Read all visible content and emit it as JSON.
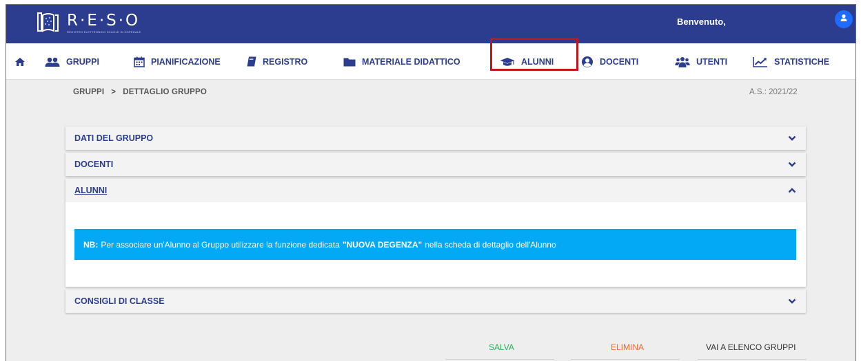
{
  "header": {
    "logo_title": "R·E·S·O",
    "logo_subtitle": "REGISTRO ELETTRONICO SCUOLE IN OSPEDALE",
    "welcome": "Benvenuto,"
  },
  "nav": {
    "items": [
      {
        "label": "GRUPPI",
        "icon": "users-icon"
      },
      {
        "label": "PIANIFICAZIONE",
        "icon": "calendar-icon"
      },
      {
        "label": "REGISTRO",
        "icon": "book-icon"
      },
      {
        "label": "MATERIALE DIDATTICO",
        "icon": "folder-icon"
      },
      {
        "label": "ALUNNI",
        "icon": "graduation-cap-icon"
      },
      {
        "label": "DOCENTI",
        "icon": "user-circle-icon"
      },
      {
        "label": "UTENTI",
        "icon": "group-icon"
      },
      {
        "label": "STATISTICHE",
        "icon": "chart-line-icon"
      }
    ]
  },
  "breadcrumb": {
    "root": "GRUPPI",
    "separator": ">",
    "current": "DETTAGLIO GRUPPO"
  },
  "year": "A.S.: 2021/22",
  "sections": {
    "dati": "DATI DEL GRUPPO",
    "docenti": "DOCENTI",
    "alunni": "ALUNNI",
    "consigli": "CONSIGLI DI CLASSE"
  },
  "note": {
    "prefix": "NB:",
    "text_before": "Per associare un'Alunno al Gruppo utilizzare la funzione dedicata",
    "highlight": "\"NUOVA DEGENZA\"",
    "text_after": "nella scheda di dettaglio dell'Alunno"
  },
  "actions": {
    "save": "SALVA",
    "delete": "ELIMINA",
    "back": "VAI A ELENCO GRUPPI"
  },
  "colors": {
    "header": "#2c3c8e",
    "note": "#03a9f4",
    "save": "#2fae5a",
    "delete": "#ef6a2e",
    "highlight_box": "#c0161b"
  }
}
